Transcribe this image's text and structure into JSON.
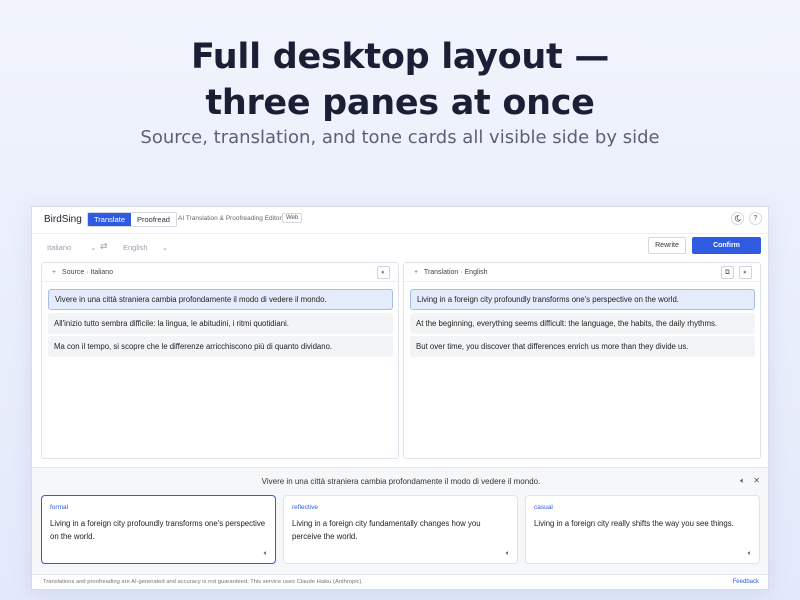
{
  "hero": {
    "title_line1": "Full desktop layout —",
    "title_line2": "three panes at once",
    "subtitle": "Source, translation, and tone cards all visible side by side"
  },
  "app": {
    "brand": "BirdSing",
    "modes": [
      "Translate",
      "Proofread"
    ],
    "active_mode": "Translate",
    "tagline": "AI Translation & Proofreading Editor",
    "platform_tag": "Web",
    "icons": {
      "theme": "moon-icon",
      "help": "help-icon"
    },
    "help_glyph": "?",
    "source_lang": "Italiano",
    "target_lang": "English",
    "rewrite_label": "Rewrite",
    "confirm_label": "Confirm",
    "accent_color": "#2f5be0"
  },
  "source_pane": {
    "title": "Source · Italiano",
    "segments": [
      "Vivere in una città straniera cambia profondamente il modo di vedere il mondo.",
      "All'inizio tutto sembra difficile: la lingua, le abitudini, i ritmi quotidiani.",
      "Ma con il tempo, si scopre che le differenze arricchiscono più di quanto dividano."
    ],
    "selected_index": 0
  },
  "translation_pane": {
    "title": "Translation · English",
    "segments": [
      "Living in a foreign city profoundly transforms one's perspective on the world.",
      "At the beginning, everything seems difficult: the language, the habits, the daily rhythms.",
      "But over time, you discover that differences enrich us more than they divide us."
    ],
    "selected_index": 0
  },
  "tone": {
    "source_sentence": "Vivere in una città straniera cambia profondamente il modo di vedere il mondo.",
    "cards": [
      {
        "label": "formal",
        "text": "Living in a foreign city profoundly transforms one's perspective on the world."
      },
      {
        "label": "reflective",
        "text": "Living in a foreign city fundamentally changes how you perceive the world."
      },
      {
        "label": "casual",
        "text": "Living in a foreign city really shifts the way you see things."
      }
    ],
    "selected_index": 0
  },
  "footer": {
    "note": "Translations and proofreading are AI-generated and accuracy is not guaranteed. This service uses Claude Haiku (Anthropic).",
    "feedback": "Feedback"
  }
}
